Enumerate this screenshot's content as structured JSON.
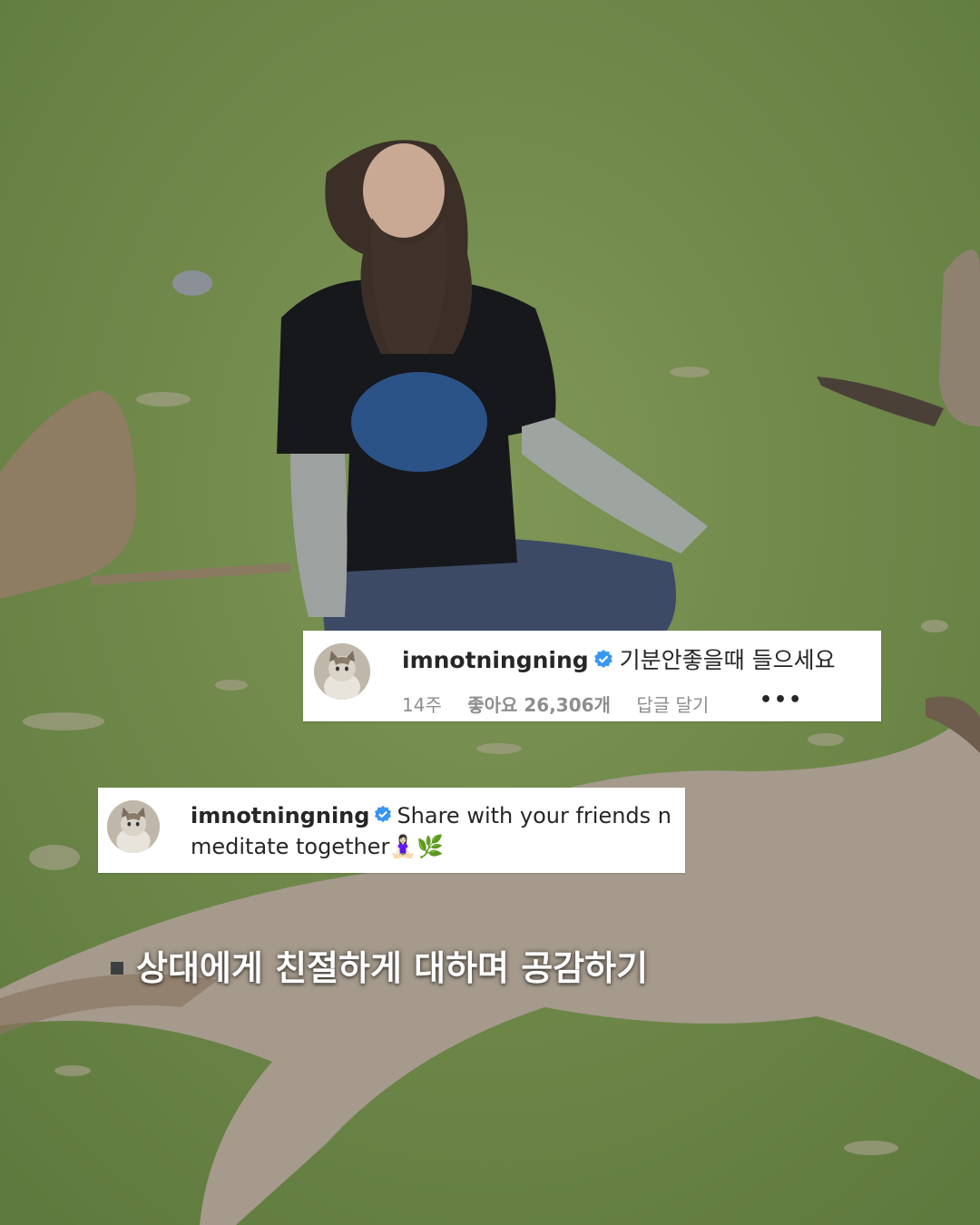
{
  "comment_top": {
    "username": "imnotningning",
    "verified_icon": "verified-badge-icon",
    "text": "기분안좋을때 들으세요",
    "time": "14주",
    "likes": "좋아요 26,306개",
    "reply": "답글 달기",
    "more": "•••"
  },
  "comment_bottom": {
    "username": "imnotningning",
    "verified_icon": "verified-badge-icon",
    "text": "Share with your friends n meditate together🧘🏻‍♀️🌿"
  },
  "subtitle": "상대에게 친절하게 대하며 공감하기",
  "colors": {
    "grass": "#6f8a4a",
    "verified": "#3897f0",
    "card": "#ffffff"
  }
}
